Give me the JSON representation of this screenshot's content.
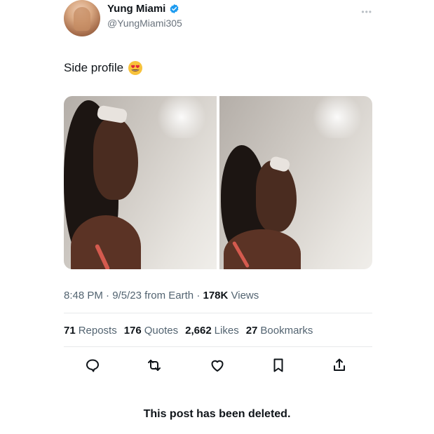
{
  "author": {
    "display_name": "Yung Miami",
    "handle": "@YungMiami305",
    "verified": true,
    "avatar_icon": "profile-photo"
  },
  "tweet": {
    "text": "Side profile",
    "emoji_icon": "smiling-face-with-heart-eyes-icon",
    "media_count": 2
  },
  "meta": {
    "time": "8:48 PM",
    "date": "9/5/23",
    "source": "from Earth",
    "separator": "·",
    "views_count": "178K",
    "views_label": "Views"
  },
  "stats": {
    "reposts_count": "71",
    "reposts_label": "Reposts",
    "quotes_count": "176",
    "quotes_label": "Quotes",
    "likes_count": "2,662",
    "likes_label": "Likes",
    "bookmarks_count": "27",
    "bookmarks_label": "Bookmarks"
  },
  "actions": {
    "icons": [
      "reply-icon",
      "repost-icon",
      "like-icon",
      "bookmark-icon",
      "share-icon"
    ]
  },
  "notice": "This post has been deleted.",
  "colors": {
    "verified_badge": "#1d9bf0",
    "text_primary": "#0f1419",
    "text_secondary": "#536471",
    "divider": "#e7e9ea"
  }
}
